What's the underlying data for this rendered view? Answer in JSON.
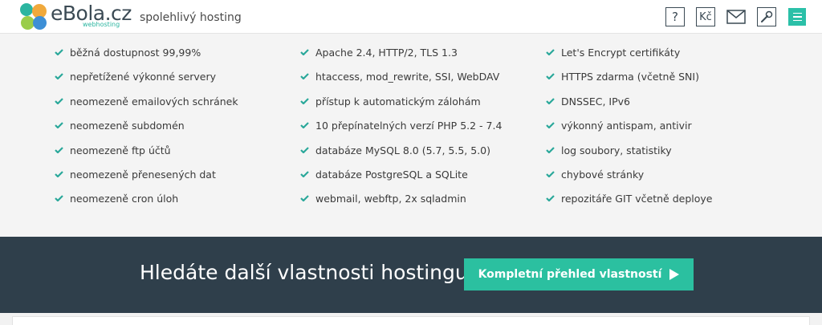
{
  "header": {
    "brand": "eBola.cz",
    "brand_sub": "webhosting",
    "tagline": "spolehlivý hosting",
    "icons": {
      "help": "?",
      "price": "Kč"
    }
  },
  "features": {
    "col1": [
      "běžná dostupnost 99,99%",
      "nepřetížené výkonné servery",
      "neomezeně emailových schránek",
      "neomezeně subdomén",
      "neomezeně ftp účtů",
      "neomezeně přenesených dat",
      "neomezeně cron úloh"
    ],
    "col2": [
      "Apache 2.4, HTTP/2, TLS 1.3",
      "htaccess, mod_rewrite, SSI, WebDAV",
      "přístup k automatickým zálohám",
      "10 přepínatelných verzí PHP 5.2 - 7.4",
      "databáze MySQL 8.0 (5.7, 5.5, 5.0)",
      "databáze PostgreSQL a SQLite",
      "webmail, webftp, 2x sqladmin"
    ],
    "col3": [
      "Let's Encrypt certifikáty",
      "HTTPS zdarma (včetně SNI)",
      "DNSSEC, IPv6",
      "výkonný antispam, antivir",
      "log soubory, statistiky",
      "chybové stránky",
      "repozitáře GIT včetně deploye"
    ]
  },
  "banner": {
    "text": "Hledáte další vlastnosti hostingu?",
    "cta_label": "Kompletní přehled vlastností"
  },
  "colors": {
    "accent": "#2bc0a0",
    "banner_bg": "#2f3f4b",
    "check": "#2aa89a"
  }
}
